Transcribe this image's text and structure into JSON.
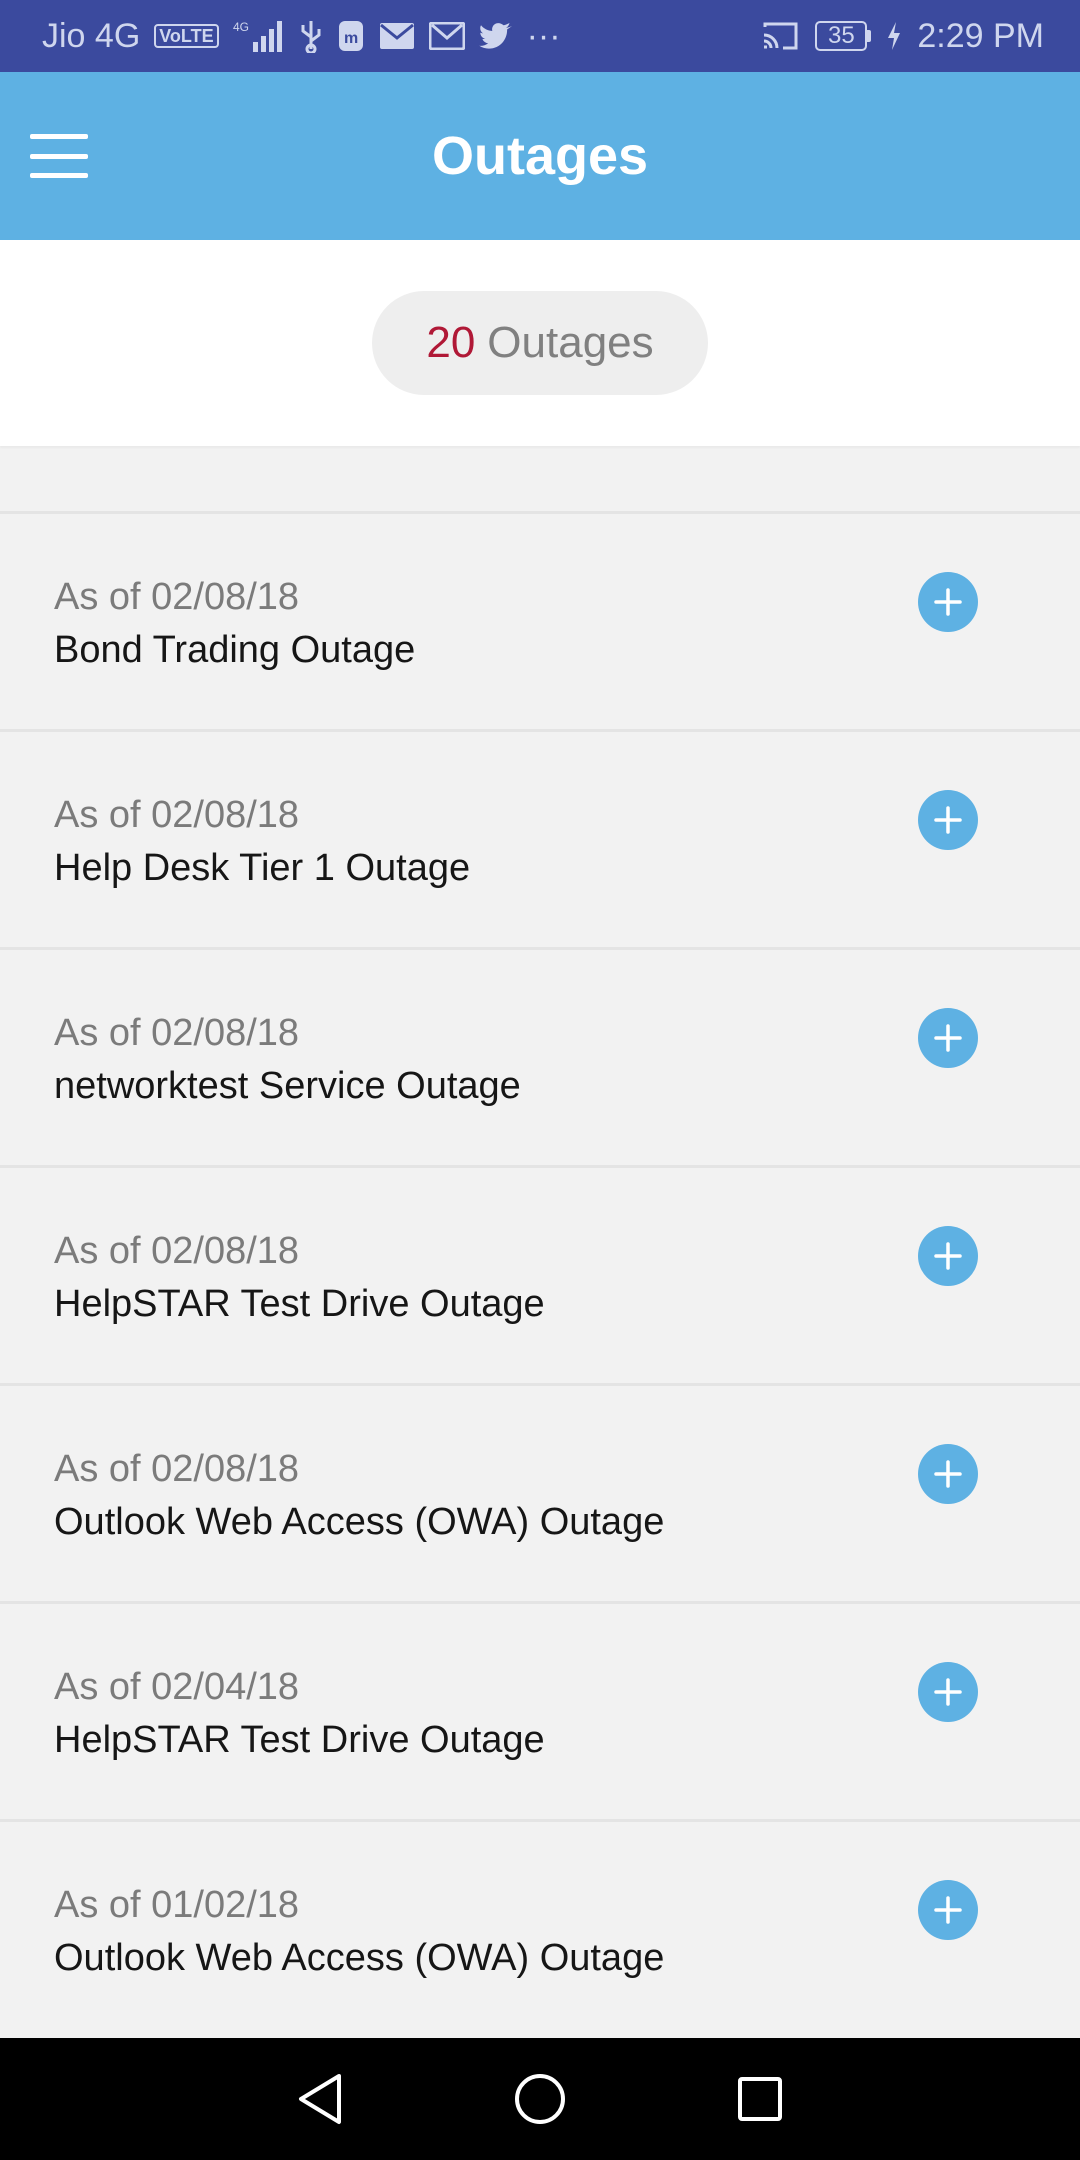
{
  "status_bar": {
    "carrier": "Jio 4G",
    "volte": "VoLTE",
    "network": "4G",
    "battery": "35",
    "time": "2:29 PM",
    "more": "···"
  },
  "app_bar": {
    "title": "Outages"
  },
  "summary": {
    "count": "20",
    "label": "Outages"
  },
  "outages": [
    {
      "date": "As of 02/08/18",
      "title": "Bond Trading Outage"
    },
    {
      "date": "As of 02/08/18",
      "title": "Help Desk Tier 1 Outage"
    },
    {
      "date": "As of 02/08/18",
      "title": "networktest Service Outage"
    },
    {
      "date": "As of 02/08/18",
      "title": "HelpSTAR Test Drive Outage"
    },
    {
      "date": "As of 02/08/18",
      "title": "Outlook Web Access (OWA) Outage"
    },
    {
      "date": "As of 02/04/18",
      "title": "HelpSTAR Test Drive Outage"
    },
    {
      "date": "As of 01/02/18",
      "title": "Outlook Web Access (OWA) Outage"
    }
  ],
  "colors": {
    "status_bar": "#3b4a9e",
    "app_bar": "#5eb1e3",
    "count_accent": "#b01836",
    "add_button": "#5eb1e3"
  },
  "icons": {
    "menu": "hamburger-menu-icon",
    "add": "plus-circle-icon",
    "back": "triangle-back-icon",
    "home": "circle-home-icon",
    "recents": "square-recents-icon"
  }
}
